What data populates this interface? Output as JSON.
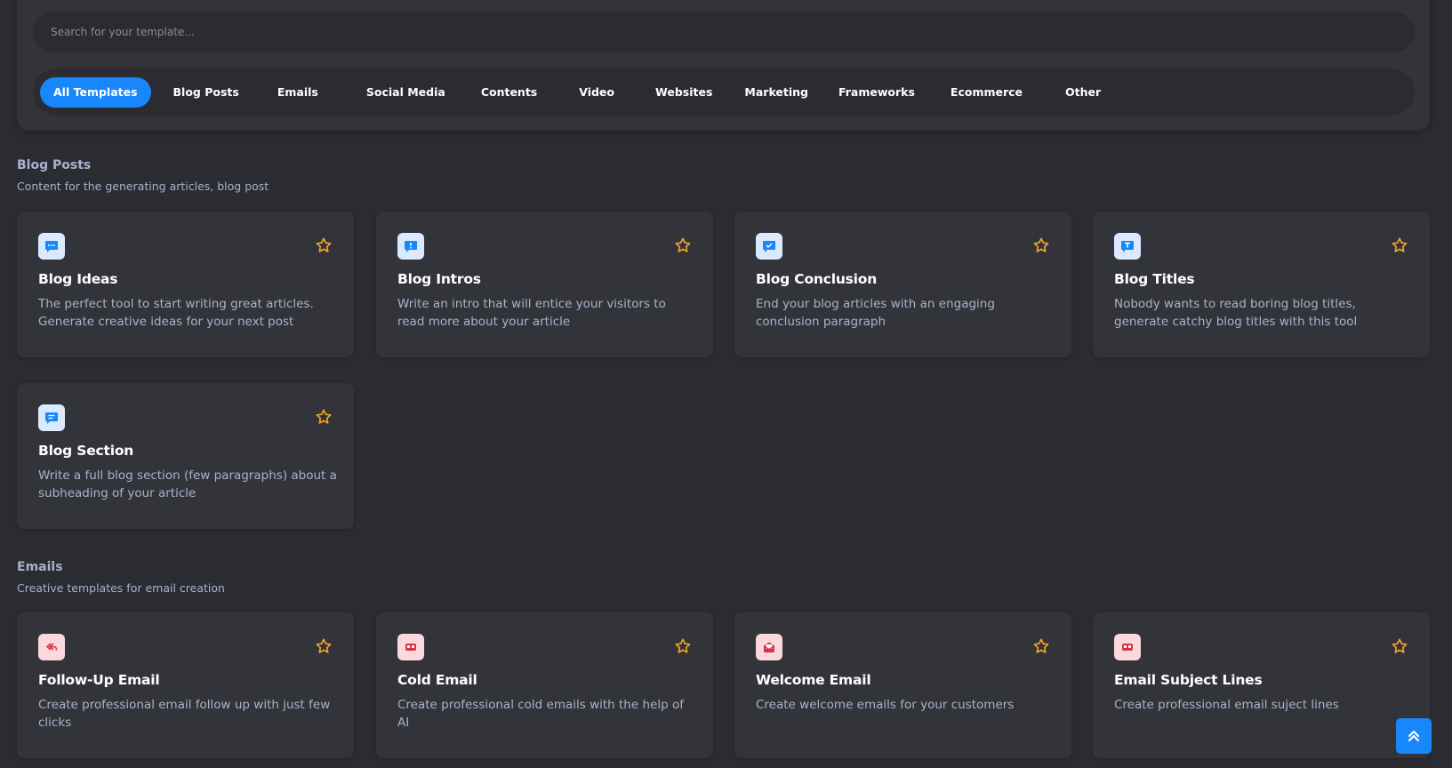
{
  "search": {
    "placeholder": "Search for your template..."
  },
  "tabs": [
    {
      "label": "All Templates",
      "active": true
    },
    {
      "label": "Blog Posts"
    },
    {
      "label": "Emails"
    },
    {
      "label": "Social Media"
    },
    {
      "label": "Contents"
    },
    {
      "label": "Video"
    },
    {
      "label": "Websites"
    },
    {
      "label": "Marketing"
    },
    {
      "label": "Frameworks"
    },
    {
      "label": "Ecommerce"
    },
    {
      "label": "Other"
    }
  ],
  "sections": {
    "blog": {
      "title": "Blog Posts",
      "subtitle": "Content for the generating articles, blog post",
      "cards": [
        {
          "title": "Blog Ideas",
          "desc": "The perfect tool to start writing great articles. Generate creative ideas for your next post",
          "icon": "chat-dots-icon"
        },
        {
          "title": "Blog Intros",
          "desc": "Write an intro that will entice your visitors to read more about your article",
          "icon": "chat-exclamation-icon"
        },
        {
          "title": "Blog Conclusion",
          "desc": "End your blog articles with an engaging conclusion paragraph",
          "icon": "chat-check-icon"
        },
        {
          "title": "Blog Titles",
          "desc": "Nobody wants to read boring blog titles, generate catchy blog titles with this tool",
          "icon": "chat-text-icon"
        },
        {
          "title": "Blog Section",
          "desc": "Write a full blog section (few paragraphs) about a subheading of your article",
          "icon": "chat-lines-icon"
        }
      ]
    },
    "emails": {
      "title": "Emails",
      "subtitle": "Creative templates for email creation",
      "cards": [
        {
          "title": "Follow-Up Email",
          "desc": "Create professional email follow up with just few clicks",
          "icon": "reply-all-icon"
        },
        {
          "title": "Cold Email",
          "desc": "Create professional cold emails with the help of AI",
          "icon": "mailbox-icon"
        },
        {
          "title": "Welcome Email",
          "desc": "Create welcome emails for your customers",
          "icon": "envelope-open-icon"
        },
        {
          "title": "Email Subject Lines",
          "desc": "Create professional email suject lines",
          "icon": "mailbox-icon"
        }
      ]
    }
  },
  "colors": {
    "accent": "#1787fb",
    "star": "#f4a52c",
    "background": "#2b2c31",
    "card": "#33343a",
    "muted_text": "#a8b2cc"
  }
}
